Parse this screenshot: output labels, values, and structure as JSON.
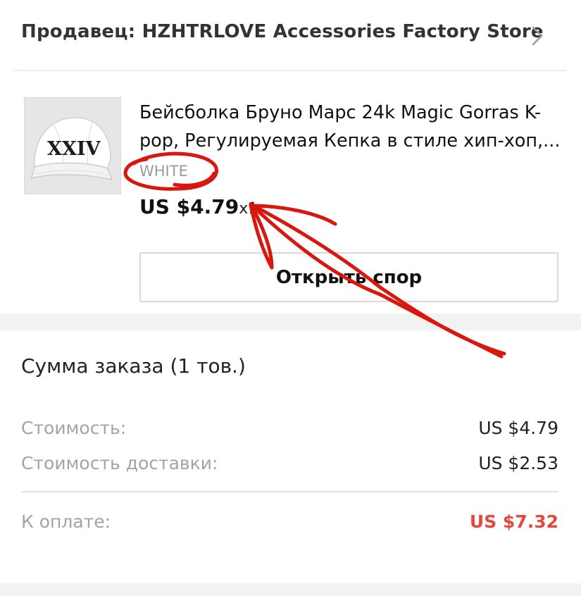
{
  "seller": {
    "label": "Продавец: HZHTRLOVE Accessories Factory Store"
  },
  "product": {
    "image_text": "XXIV",
    "title_line1": "Бейсболка Бруно Марс 24k Magic Gorras K-",
    "title_line2": "pop, Регулируемая Кепка в стиле хип-хоп,...",
    "variant": "WHITE",
    "price": "US $4.79",
    "quantity": "x1"
  },
  "actions": {
    "dispute_label": "Открыть спор"
  },
  "summary": {
    "title": "Сумма заказа (1 тов.)",
    "cost_label": "Стоимость:",
    "cost_value": "US $4.79",
    "shipping_label": "Стоимость доставки:",
    "shipping_value": "US $2.53",
    "total_label": "К оплате:",
    "total_value": "US $7.32"
  },
  "colors": {
    "accent_red": "#e4473e",
    "annotation_red": "#d8170f",
    "muted_text": "#a3a3a3"
  },
  "icons": {
    "seller_chevron": "chevron-right-icon"
  }
}
